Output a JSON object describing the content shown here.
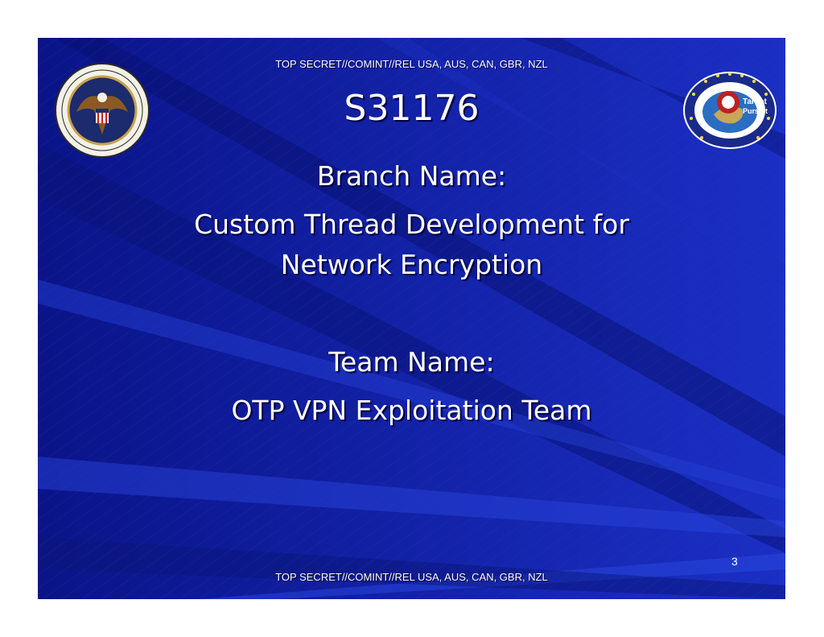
{
  "classification": {
    "top": "TOP SECRET//COMINT//REL USA, AUS, CAN, GBR, NZL",
    "bottom": "TOP SECRET//COMINT//REL USA, AUS, CAN, GBR, NZL"
  },
  "title": "S31176",
  "branch": {
    "label": "Branch Name:",
    "line1": "Custom Thread Development for",
    "line2": "Network Encryption"
  },
  "team": {
    "label": "Team Name:",
    "value": "OTP VPN Exploitation Team"
  },
  "page_number": "3",
  "logos": {
    "left": {
      "icon": "nsa-seal-icon",
      "ring_text": "NATIONAL SECURITY AGENCY · UNITED STATES OF AMERICA"
    },
    "right": {
      "icon": "target-pursuit-seal-icon",
      "text_line1": "Target",
      "text_line2": "Pursuit"
    }
  },
  "colors": {
    "background": "#0e1a9a",
    "text": "#ffffff",
    "streak": "#1b35c8"
  }
}
